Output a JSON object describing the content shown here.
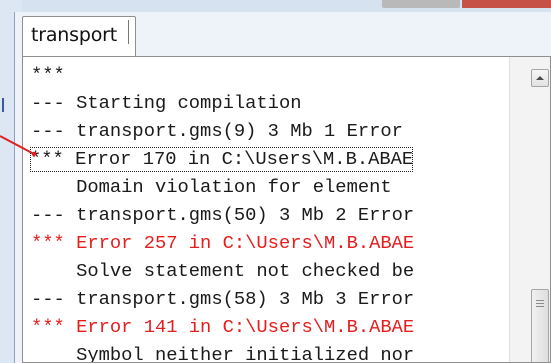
{
  "tab": {
    "label": "transport"
  },
  "log": {
    "lines": [
      {
        "text": "***",
        "color": "black"
      },
      {
        "text": "--- Starting compilation",
        "color": "black"
      },
      {
        "text": "--- transport.gms(9) 3 Mb 1 Error",
        "color": "black"
      },
      {
        "text": "*** Error 170 in C:\\Users\\M.B.ABAE",
        "color": "black",
        "selected": true
      },
      {
        "text": "    Domain violation for element",
        "color": "black"
      },
      {
        "text": "--- transport.gms(50) 3 Mb 2 Error",
        "color": "black"
      },
      {
        "text": "*** Error 257 in C:\\Users\\M.B.ABAE",
        "color": "red"
      },
      {
        "text": "    Solve statement not checked be",
        "color": "black"
      },
      {
        "text": "--- transport.gms(58) 3 Mb 3 Error",
        "color": "black"
      },
      {
        "text": "*** Error 141 in C:\\Users\\M.B.ABAE",
        "color": "red"
      },
      {
        "text": "    Symbol neither initialized nor",
        "color": "black"
      }
    ]
  },
  "colors": {
    "error_text": "#e81c1c",
    "normal_text": "#1a1a1a",
    "annotation_arrow": "#e02020"
  },
  "icons": {
    "scroll_up": "chevron-up-icon",
    "scroll_grip": "grip-lines-icon"
  }
}
